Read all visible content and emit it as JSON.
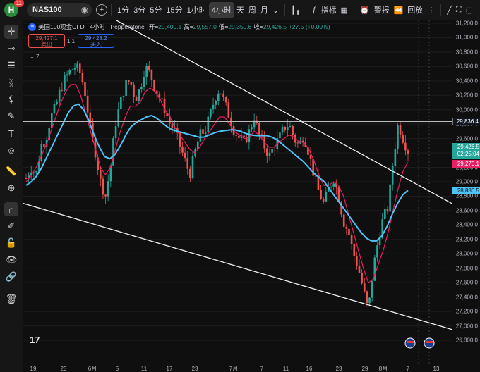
{
  "header": {
    "avatar_letter": "H",
    "notification_count": "11",
    "symbol": "NAS100",
    "timeframes": [
      "1分",
      "3分",
      "5分",
      "15分",
      "1小时",
      "4小时",
      "天",
      "周",
      "月"
    ],
    "active_timeframe_index": 5,
    "indicators_label": "指标",
    "alert_label": "警报",
    "replay_label": "回放"
  },
  "legend": {
    "title": "美国100现金CFD · 4小时 · Pepperstone",
    "open_label": "开=",
    "open": "29,400.1",
    "high_label": "高=",
    "high": "29,557.0",
    "low_label": "低=",
    "low": "29,359.6",
    "close_label": "收=",
    "close": "29,426.5",
    "change": "+27.5 (+0.09%)",
    "sell_price": "29,427.1",
    "sell_label": "卖出",
    "spread": "1.1",
    "buy_price": "29,428.2",
    "buy_label": "买入",
    "indicator_count": "7"
  },
  "price_labels": {
    "hline": "29,836.4",
    "current": "29,426.5",
    "countdown": "02:25:04",
    "ma_red": "29,270.1",
    "ma_blue": "28,880.5"
  },
  "colors": {
    "up": "#26a69a",
    "down": "#ef5350",
    "ma_red": "#e91e63",
    "ma_blue": "#4fc3f7",
    "hline_label_bg": "#131722",
    "accent_blue": "#2962ff"
  },
  "chart_data": {
    "type": "candlestick",
    "instrument": "NAS100",
    "timeframe": "4小时",
    "ylim": [
      26800,
      31200
    ],
    "yticks": [
      "31,200.0",
      "31,000.0",
      "30,800.0",
      "30,600.0",
      "30,400.0",
      "30,200.0",
      "30,000.0",
      "29,800.0",
      "29,600.0",
      "29,400.0",
      "29,200.0",
      "29,000.0",
      "28,800.0",
      "28,600.0",
      "28,400.0",
      "28,200.0",
      "28,000.0",
      "27,800.0",
      "27,600.0",
      "27,400.0",
      "27,200.0",
      "27,000.0",
      "26,800.0"
    ],
    "xticks": [
      "19",
      "23",
      "6月",
      "5",
      "11",
      "17",
      "23",
      "7月",
      "7",
      "11",
      "16",
      "23",
      "29",
      "8月",
      "7",
      "13"
    ],
    "price_path": [
      29050,
      29200,
      29100,
      29500,
      29600,
      29900,
      30050,
      30300,
      30450,
      30550,
      30600,
      30500,
      30200,
      29700,
      29400,
      29000,
      28800,
      29200,
      29800,
      30100,
      30350,
      30400,
      30150,
      30300,
      30600,
      30500,
      30300,
      30150,
      30000,
      29800,
      29700,
      29500,
      29300,
      29100,
      29400,
      29650,
      29700,
      29900,
      30150,
      30300,
      30100,
      29900,
      29700,
      29600,
      29550,
      29700,
      29900,
      29650,
      29500,
      29350,
      29500,
      29600,
      29750,
      29800,
      29600,
      29500,
      29650,
      29400,
      29100,
      28850,
      28700,
      28900,
      29050,
      28800,
      28450,
      28300,
      28000,
      27800,
      27500,
      27200,
      27800,
      28200,
      28500,
      28650,
      29300,
      29800,
      29600,
      29426.5
    ],
    "ma_red_path": [
      29000,
      29080,
      29200,
      29350,
      29500,
      29700,
      29900,
      30100,
      30250,
      30350,
      30350,
      30200,
      29950,
      29700,
      29450,
      29200,
      29100,
      29200,
      29450,
      29700,
      29900,
      30050,
      30050,
      30100,
      30250,
      30300,
      30250,
      30150,
      30000,
      29900,
      29750,
      29650,
      29550,
      29450,
      29400,
      29480,
      29600,
      29700,
      29800,
      29900,
      29900,
      29800,
      29700,
      29650,
      29600,
      29620,
      29700,
      29650,
      29550,
      29480,
      29480,
      29550,
      29600,
      29650,
      29620,
      29560,
      29550,
      29450,
      29300,
      29100,
      28950,
      28950,
      29000,
      28950,
      28800,
      28550,
      28300,
      28050,
      27800,
      27600,
      27650,
      27850,
      28050,
      28300,
      28600,
      28900,
      29150,
      29270.1
    ],
    "ma_blue_path": [
      28950,
      29000,
      29080,
      29200,
      29350,
      29500,
      29650,
      29800,
      29950,
      30050,
      30080,
      30000,
      29850,
      29650,
      29480,
      29350,
      29320,
      29380,
      29500,
      29640,
      29760,
      29820,
      29860,
      29900,
      29920,
      29880,
      29820,
      29760,
      29720,
      29700,
      29680,
      29660,
      29640,
      29620,
      29620,
      29650,
      29680,
      29700,
      29710,
      29720,
      29720,
      29700,
      29670,
      29650,
      29640,
      29640,
      29640,
      29620,
      29580,
      29520,
      29460,
      29400,
      29340,
      29280,
      29200,
      29120,
      29060,
      29000,
      28900,
      28800,
      28700,
      28600,
      28500,
      28400,
      28300,
      28220,
      28180,
      28180,
      28250,
      28380,
      28550,
      28700,
      28820,
      28880.5
    ],
    "trendlines": [
      {
        "from_price": 31250,
        "to_price": 28700
      },
      {
        "from_price": 28700,
        "to_price": 26950
      }
    ],
    "horizontal_line": 29836.4
  }
}
